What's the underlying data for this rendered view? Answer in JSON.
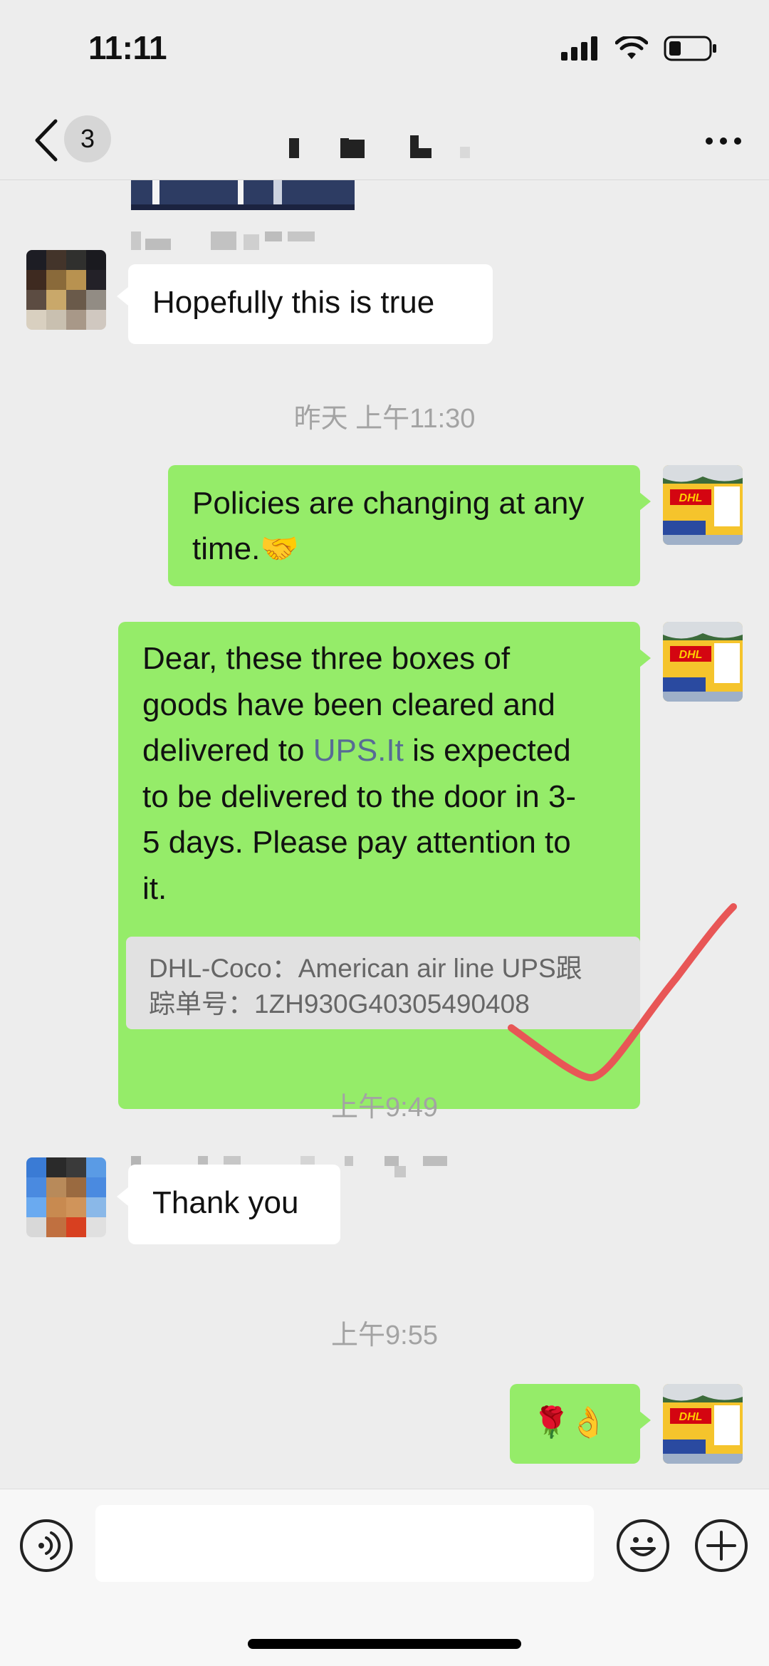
{
  "status_bar": {
    "time": "11:11"
  },
  "nav": {
    "unread_count": "3"
  },
  "messages": {
    "m1_text": "Hopefully this is true",
    "ts1": "昨天 上午11:30",
    "m2_text": "Policies are changing at any time.🤝",
    "m3_line1": "Dear, these three boxes of",
    "m3_line2": "goods have been cleared and",
    "m3_line3_pre": "delivered to ",
    "m3_link": "UPS.It",
    "m3_line3_post": " is expected",
    "m3_line4": "to be delivered to the door in 3-",
    "m3_line5": "5 days. Please pay attention to",
    "m3_line6": "it.",
    "quote_line1": "DHL-Coco：American air line UPS跟",
    "quote_line2": "踪单号：1ZH930G40305490408",
    "ts2": "上午9:49",
    "m4_text": "Thank you",
    "ts3": "上午9:55",
    "m5_text": "🌹👌"
  },
  "colors": {
    "outgoing_bubble": "#95ec69",
    "incoming_bubble": "#ffffff",
    "link": "#576b95",
    "checkmark": "#e85656"
  },
  "icons": [
    "back-chevron-icon",
    "more-dots-icon",
    "voice-icon",
    "emoji-icon",
    "plus-icon",
    "signal-icon",
    "wifi-icon",
    "battery-icon"
  ]
}
